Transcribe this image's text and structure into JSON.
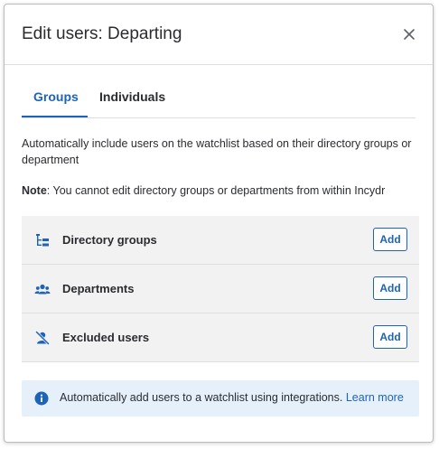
{
  "dialog": {
    "title": "Edit users: Departing"
  },
  "tabs": [
    {
      "label": "Groups",
      "active": true
    },
    {
      "label": "Individuals",
      "active": false
    }
  ],
  "description": "Automatically include users on the watchlist based on their directory groups or department",
  "note": {
    "label": "Note",
    "text": ": You cannot edit directory groups or departments from within Incydr"
  },
  "rows": [
    {
      "label": "Directory groups",
      "icon": "directory-groups-icon",
      "button": "Add"
    },
    {
      "label": "Departments",
      "icon": "departments-icon",
      "button": "Add"
    },
    {
      "label": "Excluded users",
      "icon": "excluded-user-icon",
      "button": "Add"
    }
  ],
  "info": {
    "text": "Automatically add users to a watchlist using integrations.",
    "link": "Learn more",
    "icon": "info-icon"
  },
  "colors": {
    "accent": "#1d63b8",
    "info_bg": "#e5f0fa",
    "row_bg": "#f2f2f3"
  }
}
